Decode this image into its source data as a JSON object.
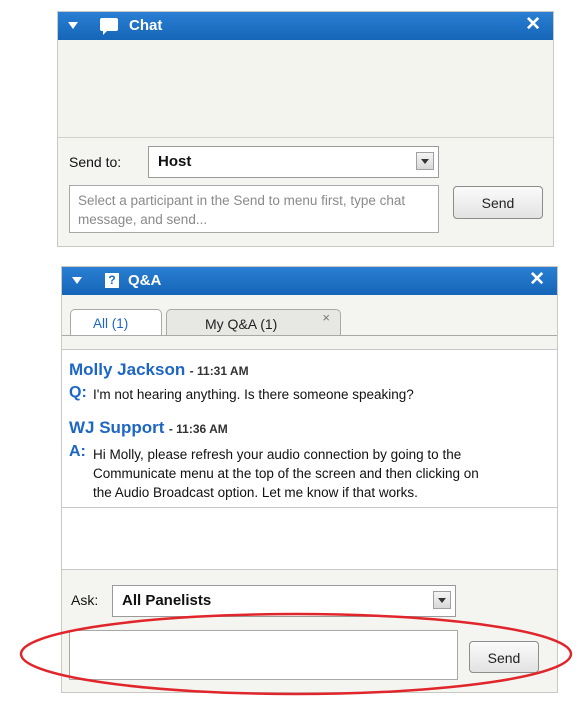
{
  "chat": {
    "title": "Chat",
    "send_to_label": "Send to:",
    "send_to_value": "Host",
    "message_placeholder": "Select a participant in the Send to menu first, type chat message, and send...",
    "send_label": "Send",
    "close_glyph": "✕"
  },
  "qa": {
    "title": "Q&A",
    "title_icon": "?",
    "close_glyph": "✕",
    "tabs": [
      {
        "label": "All (1)",
        "active": true
      },
      {
        "label": "My Q&A (1)",
        "active": false,
        "close_glyph": "×"
      }
    ],
    "entries": [
      {
        "author": "Molly Jackson",
        "time": "- 11:31 AM",
        "prefix": "Q:",
        "lines": [
          "I'm not hearing anything. Is there someone speaking?"
        ]
      },
      {
        "author": "WJ Support",
        "time": "- 11:36 AM",
        "prefix": "A:",
        "lines": [
          "Hi Molly, please refresh your audio connection by going to the",
          "Communicate menu at the top of the screen and then clicking on",
          "the Audio Broadcast option. Let me know if that works."
        ]
      }
    ],
    "ask_label": "Ask:",
    "ask_value": "All Panelists",
    "send_label": "Send"
  },
  "colors": {
    "titlebar": "#1a6fc8",
    "accent_text": "#1d66c4",
    "highlight_ellipse": "#e0262b"
  }
}
